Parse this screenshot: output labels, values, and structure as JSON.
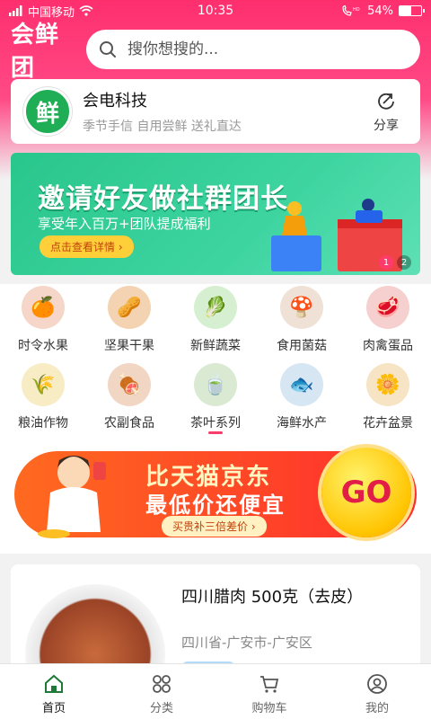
{
  "status_bar": {
    "carrier": "中国移动",
    "time": "10:35",
    "battery_text": "54%",
    "battery_level": 0.54,
    "signal_label": "HD"
  },
  "header": {
    "logo": "会鲜团",
    "search_placeholder": "搜你想搜的..."
  },
  "store": {
    "logo_char": "鲜",
    "name": "会电科技",
    "slogan": "季节手信 自用尝鲜 送礼直达",
    "share_label": "分享"
  },
  "banner": {
    "title": "邀请好友做社群团长",
    "subtitle": "享受年入百万+团队提成福利",
    "button": "点击查看详情 ›",
    "dots": [
      "1",
      "2"
    ],
    "active_index": 0,
    "colors": {
      "bg": "#29c68c",
      "button": "#ffcf3a"
    }
  },
  "categories": [
    {
      "label": "时令水果",
      "icon": "fruit-icon",
      "glyph": "🍊",
      "bg": "#f5d6c8"
    },
    {
      "label": "坚果干果",
      "icon": "nuts-icon",
      "glyph": "🥜",
      "bg": "#f3d3b2"
    },
    {
      "label": "新鲜蔬菜",
      "icon": "vegetable-icon",
      "glyph": "🥬",
      "bg": "#d6efd0"
    },
    {
      "label": "食用菌菇",
      "icon": "mushroom-icon",
      "glyph": "🍄",
      "bg": "#efe1d6"
    },
    {
      "label": "肉禽蛋品",
      "icon": "meat-icon",
      "glyph": "🥩",
      "bg": "#f6cfcf"
    },
    {
      "label": "粮油作物",
      "icon": "grain-icon",
      "glyph": "🌾",
      "bg": "#f7ecc4"
    },
    {
      "label": "农副食品",
      "icon": "food-icon",
      "glyph": "🍖",
      "bg": "#f2d6c4"
    },
    {
      "label": "茶叶系列",
      "icon": "tea-icon",
      "glyph": "🍵",
      "bg": "#d9e9d2"
    },
    {
      "label": "海鲜水产",
      "icon": "seafood-icon",
      "glyph": "🐟",
      "bg": "#d6e6f3"
    },
    {
      "label": "花卉盆景",
      "icon": "flower-icon",
      "glyph": "🌼",
      "bg": "#f7e4c4"
    }
  ],
  "promo": {
    "title": "比天猫京东",
    "subtitle": "最低价还便宜",
    "button": "买贵补三倍差价 ›",
    "go": "GO",
    "colors": {
      "bg": "#ff4a1f",
      "go": "#ffc400"
    }
  },
  "product": {
    "name": "四川腊肉 500克（去皮）",
    "location": "四川省-广安市-广安区"
  },
  "tabs": [
    {
      "label": "首页",
      "icon": "home-icon",
      "active": true
    },
    {
      "label": "分类",
      "icon": "category-icon",
      "active": false
    },
    {
      "label": "购物车",
      "icon": "cart-icon",
      "active": false
    },
    {
      "label": "我的",
      "icon": "profile-icon",
      "active": false
    }
  ],
  "accent_color": "#ff3b6b"
}
